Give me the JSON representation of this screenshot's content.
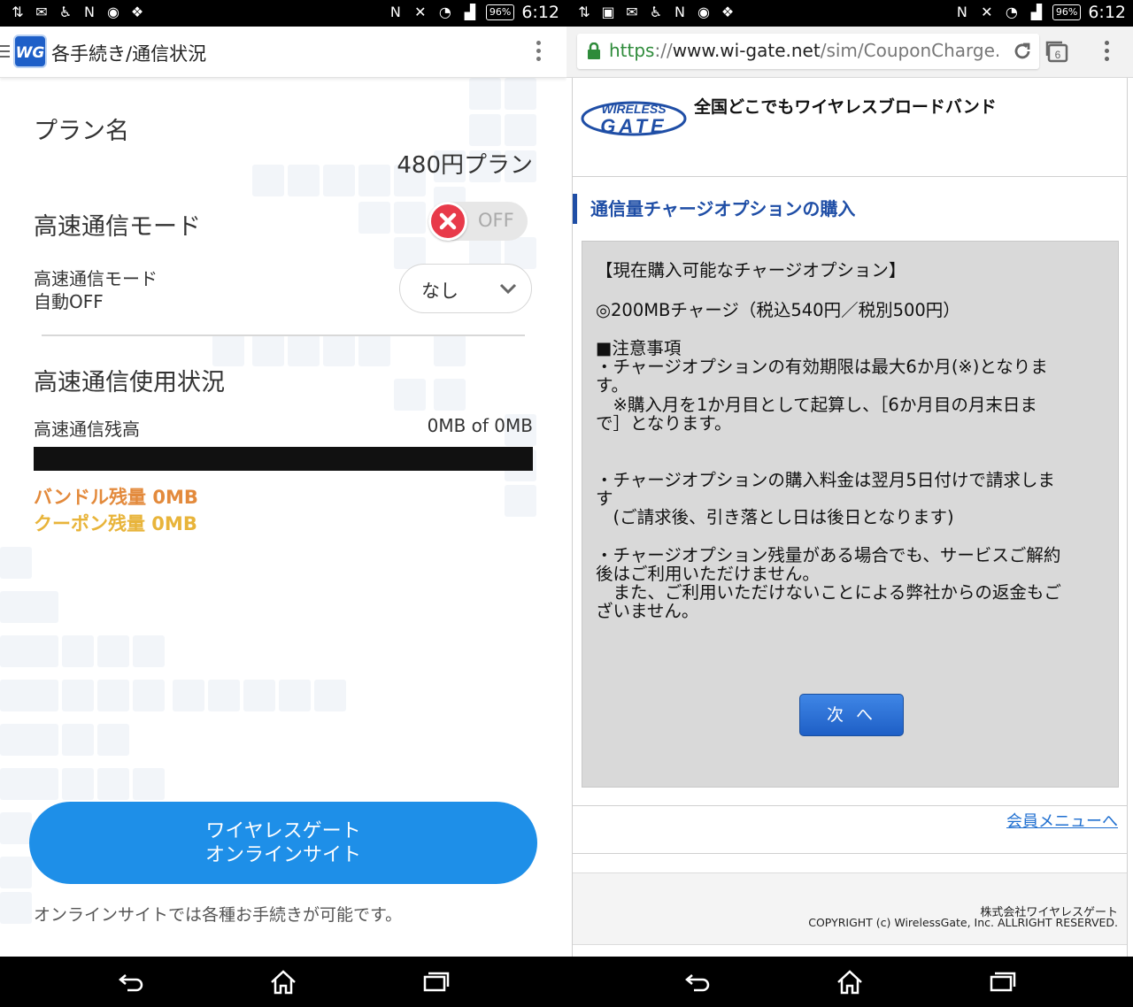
{
  "status": {
    "battery": "96%",
    "time": "6:12"
  },
  "left": {
    "app_title": "各手続き/通信状況",
    "plan_label": "プラン名",
    "plan_value": "480円プラン",
    "mode_label": "高速通信モード",
    "toggle_text": "OFF",
    "toggle_on": false,
    "auto_off_label_line1": "高速通信モード",
    "auto_off_label_line2": "自動OFF",
    "auto_off_value": "なし",
    "usage_title": "高速通信使用状況",
    "remaining_label": "高速通信残高",
    "remaining_value": "0MB of 0MB",
    "remaining_fraction": 0,
    "bundle_remaining": "バンドル残量 0MB",
    "coupon_remaining": "クーポン残量 0MB",
    "online_button_line1": "ワイヤレスゲート",
    "online_button_line2": "オンラインサイト",
    "online_note": "オンラインサイトでは各種お手続きが可能です。",
    "colors": {
      "accent": "#1e8fe8",
      "bundle": "#e38a3c",
      "coupon": "#e8b43a",
      "toggle_off": "#e83a4a"
    }
  },
  "right": {
    "url_scheme": "https",
    "url_sep": "://",
    "url_host": "www.wi-gate.net",
    "url_path": "/sim/CouponCharge.htr",
    "tab_count": "6",
    "logo_line1": "WIRELESS",
    "logo_line2": "GATE",
    "tagline": "全国どこでもワイヤレスブロードバンド",
    "section_title": "通信量チャージオプションの購入",
    "notice": {
      "heading": "【現在購入可能なチャージオプション】",
      "option": "◎200MBチャージ（税込540円／税別500円）",
      "caution_title": "■注意事項",
      "line1": "・チャージオプションの有効期限は最大6か月(※)となりま",
      "line2": "す。",
      "line3": "　※購入月を1か月目として起算し、［6か月目の月末日ま",
      "line4": "で］となります。",
      "line5": "・チャージオプションの購入料金は翌月5日付けで請求しま",
      "line6": "す",
      "line7": "　(ご請求後、引き落とし日は後日となります)",
      "line8": "・チャージオプション残量がある場合でも、サービスご解約",
      "line9": "後はご利用いただけません。",
      "line10": "　また、ご利用いただけないことによる弊社からの返金もご",
      "line11": "ざいません。"
    },
    "next_button": "次へ",
    "member_menu_link": "会員メニューへ",
    "company": "株式会社ワイヤレスゲート",
    "copyright": "COPYRIGHT (c) WirelessGate, Inc. ALLRIGHT RESERVED.",
    "colors": {
      "brand_blue": "#1f4ea6",
      "scheme_green": "#2e8b3a"
    }
  }
}
